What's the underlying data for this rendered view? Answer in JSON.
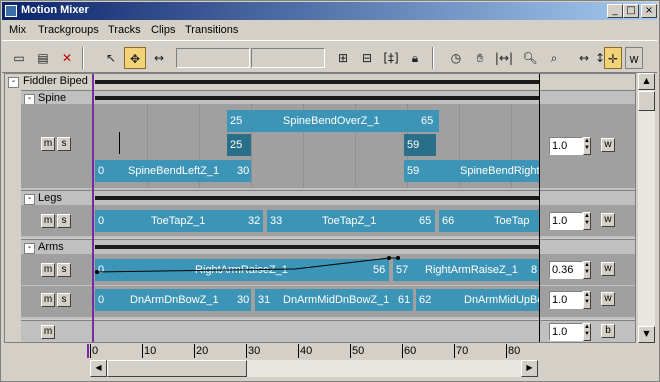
{
  "window": {
    "title": "Motion Mixer",
    "buttons": {
      "minimize": "_",
      "maximize": "□",
      "close": "×"
    }
  },
  "menu": [
    "Mix",
    "Trackgroups",
    "Tracks",
    "Clips",
    "Transitions"
  ],
  "toolbar_icons": [
    "add-track-icon",
    "add-trackgroup-icon",
    "delete-icon",
    "select-icon",
    "move-icon",
    "scale-clip-icon",
    "snap-icon",
    "fit-icon",
    "lock-icon",
    "time-icon",
    "pan-icon",
    "frame-icon",
    "zoom-icon",
    "zoom-region-icon",
    "horizontal-scale-icon",
    "vertical-scale-icon",
    "maximize-icon",
    "weight-icon"
  ],
  "toolbar_right": {
    "w_label": "w"
  },
  "groups": {
    "root": {
      "label": "Fiddler Biped",
      "toggle": "-"
    },
    "spine": {
      "label": "Spine",
      "toggle": "-",
      "m": "m",
      "s": "s",
      "weight": "1.0",
      "w": "w"
    },
    "legs": {
      "label": "Legs",
      "toggle": "-",
      "m": "m",
      "s": "s",
      "weight": "1.0",
      "w": "w"
    },
    "arms": {
      "label": "Arms",
      "toggle": "-",
      "m": "m",
      "s": "s",
      "weight1": "0.36",
      "weight2": "1.0",
      "w": "w"
    },
    "bottom": {
      "m": "m",
      "weight": "1.0",
      "b": "b"
    }
  },
  "clips": {
    "spine_top": {
      "start": "25",
      "name": "SpineBendOverZ_1",
      "end": "65"
    },
    "spine_mid_a": "25",
    "spine_mid_b": "59",
    "spine_bottom_a": {
      "start": "0",
      "name": "SpineBendLeftZ_1",
      "end": "30"
    },
    "spine_bottom_b": {
      "start": "59",
      "name": "SpineBendRight"
    },
    "legs_a": {
      "start": "0",
      "name": "ToeTapZ_1",
      "end": "32"
    },
    "legs_b": {
      "start": "33",
      "name": "ToeTapZ_1",
      "end": "65"
    },
    "legs_c": {
      "start": "66",
      "name": "ToeTap"
    },
    "arms1_a": {
      "start": "0",
      "name": "RightArmRaiseZ_1",
      "end": "56"
    },
    "arms1_b": {
      "start": "57",
      "name": "RightArmRaiseZ_1",
      "end": "8"
    },
    "arms2_a": {
      "start": "0",
      "name": "DnArmDnBowZ_1",
      "end": "30"
    },
    "arms2_b": {
      "start": "31",
      "name": "DnArmMidDnBowZ_1",
      "end": "61"
    },
    "arms2_c": {
      "start": "62",
      "name": "DnArmMidUpBo"
    }
  },
  "ruler": [
    "0",
    "10",
    "20",
    "30",
    "40",
    "50",
    "60",
    "70",
    "80"
  ]
}
